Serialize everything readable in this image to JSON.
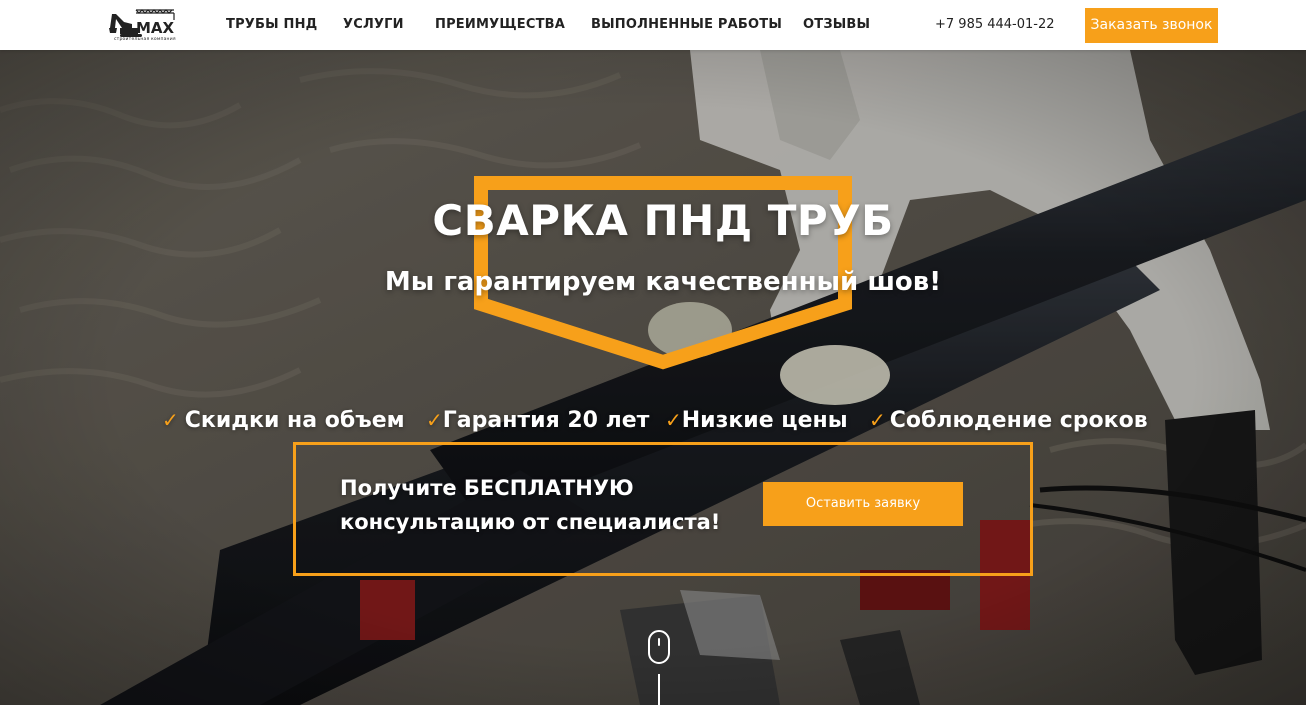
{
  "header": {
    "logo": {
      "text": "MAX",
      "subtitle": "строительная компания"
    },
    "nav": [
      {
        "label": "ТРУБЫ ПНД"
      },
      {
        "label": "УСЛУГИ"
      },
      {
        "label": "ПРЕИМУЩЕСТВА"
      },
      {
        "label": "ВЫПОЛНЕННЫЕ РАБОТЫ"
      },
      {
        "label": "ОТЗЫВЫ"
      }
    ],
    "phone": "+7 985 444-01-22",
    "call_button": "Заказать звонок"
  },
  "hero": {
    "title": "СВАРКА ПНД ТРУБ",
    "subtitle": "Мы гарантируем качественный шов!",
    "features": [
      {
        "label": "Скидки на объем"
      },
      {
        "label": "Гарантия 20 лет"
      },
      {
        "label": "Низкие цены"
      },
      {
        "label": "Соблюдение сроков"
      }
    ],
    "check_icon": "✓",
    "cta_text": "Получите БЕСПЛАТНУЮ консультацию от специалиста!",
    "cta_button": "Оставить заявку"
  },
  "colors": {
    "accent": "#f7a01a",
    "header_bg": "#ffffff",
    "text_dark": "#222222"
  },
  "icons": [
    "logo-excavator-icon",
    "check-icon",
    "scroll-mouse-icon"
  ]
}
